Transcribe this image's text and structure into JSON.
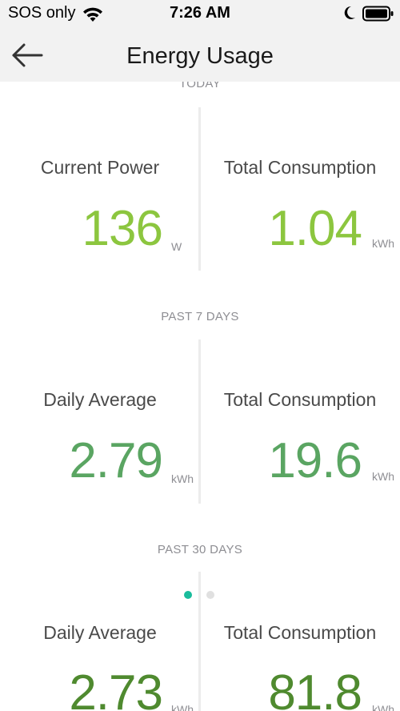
{
  "status_bar": {
    "carrier": "SOS only",
    "time": "7:26 AM",
    "wifi_icon": "wifi-icon",
    "focus_icon": "moon-icon",
    "battery_icon": "battery-icon"
  },
  "nav": {
    "back_icon": "arrow-left-icon",
    "title": "Energy Usage"
  },
  "colors": {
    "today_green": "#8cc63f",
    "week_green": "#5aa562",
    "month_green": "#4f8a2f",
    "dot_active": "#1abc9c",
    "dot_inactive": "#e0e0e0"
  },
  "sections": [
    {
      "label": "TODAY",
      "left": {
        "label": "Current Power",
        "value": "136",
        "unit": "W"
      },
      "right": {
        "label": "Total Consumption",
        "value": "1.04",
        "unit": "kWh"
      }
    },
    {
      "label": "PAST 7 DAYS",
      "left": {
        "label": "Daily Average",
        "value": "2.79",
        "unit": "kWh"
      },
      "right": {
        "label": "Total Consumption",
        "value": "19.6",
        "unit": "kWh"
      }
    },
    {
      "label": "PAST 30 DAYS",
      "left": {
        "label": "Daily Average",
        "value": "2.73",
        "unit": "kWh"
      },
      "right": {
        "label": "Total Consumption",
        "value": "81.8",
        "unit": "kWh"
      }
    }
  ],
  "pager": {
    "page_count": 2,
    "active_page": 1
  }
}
